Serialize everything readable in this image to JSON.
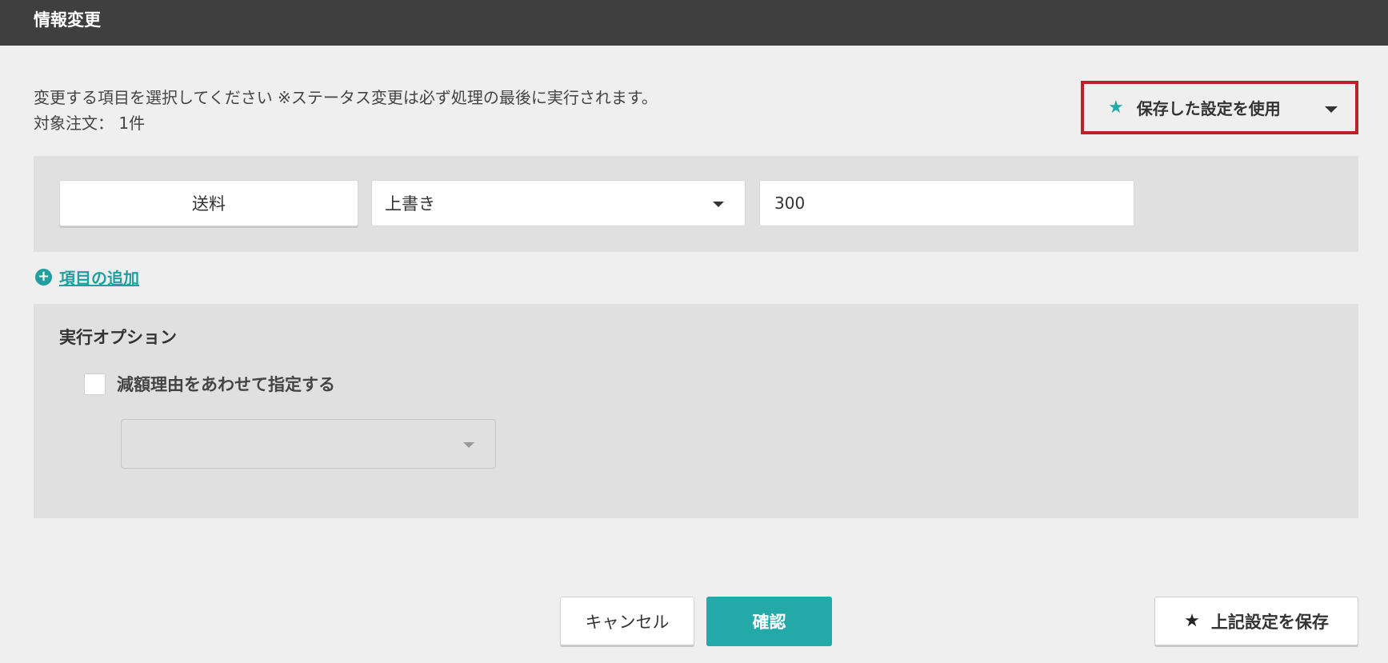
{
  "titlebar": {
    "title": "情報変更"
  },
  "instructions": {
    "line1": "変更する項目を選択してください ※ステータス変更は必ず処理の最後に実行されます。",
    "line2": "対象注文： 1件"
  },
  "saved_settings": {
    "label": "保存した設定を使用",
    "icon": "star-icon",
    "accent": "#23a9a8",
    "highlight_border": "#b8232b"
  },
  "edit_row": {
    "field_label": "送料",
    "mode_value": "上書き",
    "value": "300"
  },
  "add_item": {
    "label": "項目の追加"
  },
  "exec_options": {
    "heading": "実行オプション",
    "checkbox_label": "減額理由をあわせて指定する",
    "checkbox_checked": false,
    "reason_select_value": ""
  },
  "footer": {
    "cancel_label": "キャンセル",
    "confirm_label": "確認",
    "save_label": "上記設定を保存"
  },
  "colors": {
    "titlebar_bg": "#3f3f3f",
    "primary": "#23a9a8"
  }
}
